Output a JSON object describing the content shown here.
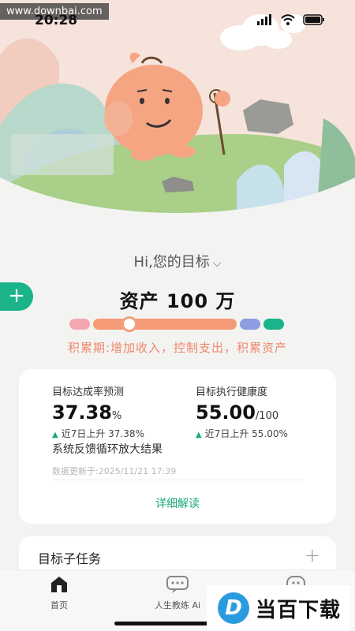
{
  "status_bar": {
    "time": "20:28",
    "watermark": "www.downbai.com"
  },
  "goal": {
    "header": "Hi,您的目标",
    "title": "资产 100 万",
    "phase": "积累期:增加收入，控制支出，积累资产"
  },
  "progress": {
    "knob_fraction": 0.28
  },
  "card": {
    "metric_left": {
      "label": "目标达成率预测",
      "value": "37.38",
      "unit": "%",
      "trend": "近7日上升 37.38%"
    },
    "metric_right": {
      "label": "目标执行健康度",
      "value": "55.00",
      "unit": "/100",
      "trend": "近7日上升 55.00%"
    },
    "summary": "系统反馈循环放大结果",
    "updated": "数据更新于:2025/11/21 17:39",
    "detail_link": "详细解读"
  },
  "subtasks": {
    "title": "目标子任务"
  },
  "tabs": [
    {
      "label": "首页",
      "icon": "home-icon"
    },
    {
      "label": "人生教练 Ai",
      "icon": "chat-bubble-icon"
    },
    {
      "label": "",
      "icon": "smiley-icon"
    }
  ],
  "brand_watermark": {
    "logo_letter": "D",
    "text": "当百下载"
  },
  "colors": {
    "accent": "#1ab38a",
    "phase": "#f0866a",
    "segments": [
      "#f3a7b0",
      "#f59a76",
      "#8c9de0",
      "#1ab38a"
    ]
  }
}
